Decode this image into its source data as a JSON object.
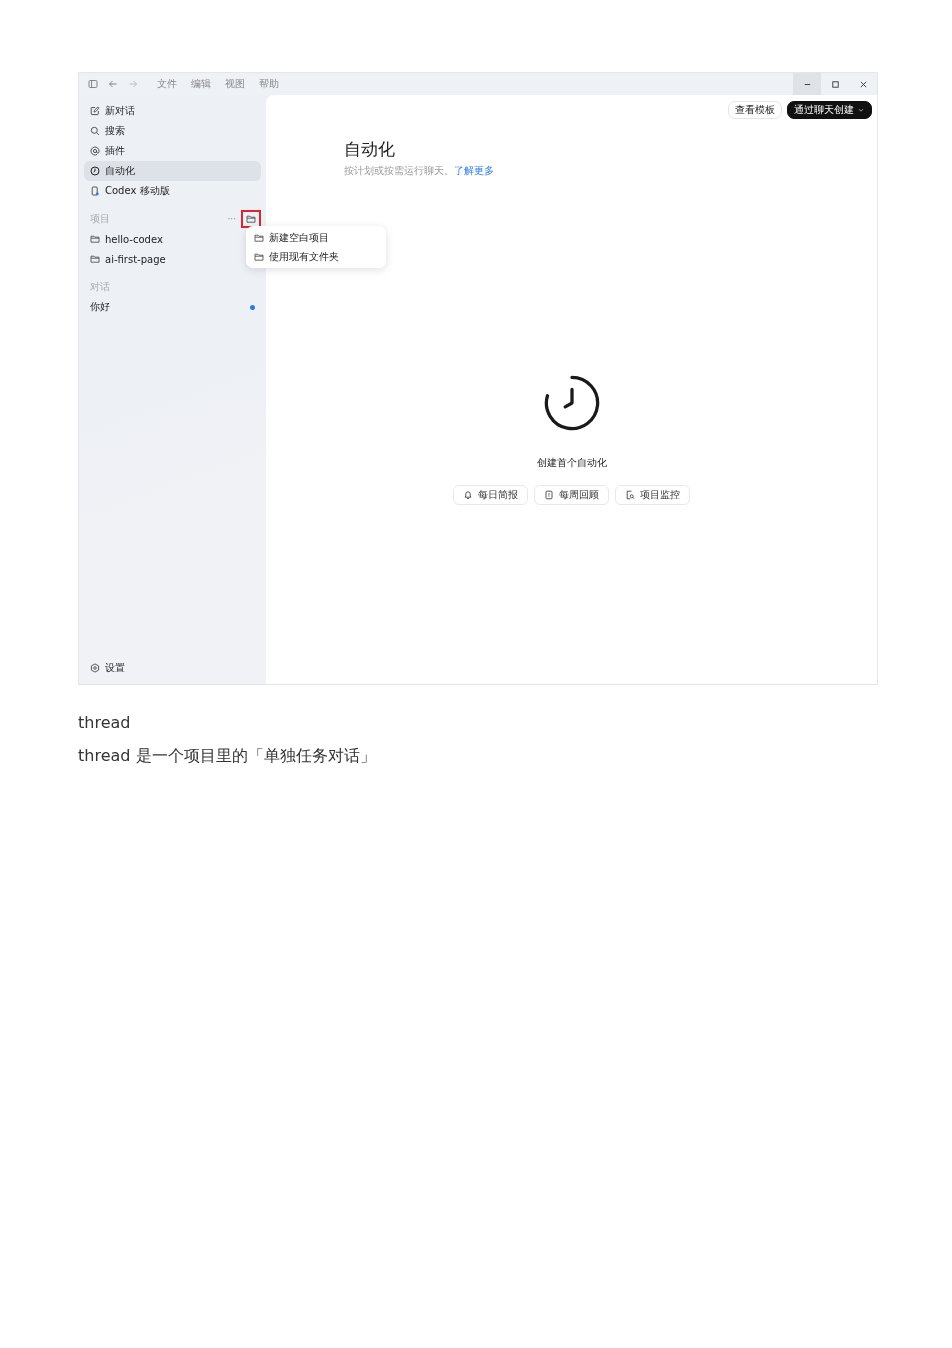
{
  "menu_bar": {
    "items": [
      "文件",
      "编辑",
      "视图",
      "帮助"
    ]
  },
  "sidebar": {
    "nav": [
      {
        "label": "新对话",
        "selected": false
      },
      {
        "label": "搜索",
        "selected": false
      },
      {
        "label": "插件",
        "selected": false
      },
      {
        "label": "自动化",
        "selected": true
      },
      {
        "label": "Codex 移动版",
        "selected": false
      }
    ],
    "projects_heading": "项目",
    "more": "···",
    "new_project_highlighted": true,
    "projects": [
      {
        "label": "hello-codex"
      },
      {
        "label": "ai-first-page"
      }
    ],
    "conversations_heading": "对话",
    "conversations": [
      {
        "label": "你好",
        "unread": true
      }
    ],
    "settings": "设置"
  },
  "popup_menu": {
    "items": [
      "新建空白项目",
      "使用现有文件夹"
    ]
  },
  "main": {
    "buttons": [
      {
        "label": "查看模板",
        "kind": "secondary"
      },
      {
        "label": "通过聊天创建",
        "kind": "primary"
      }
    ],
    "title": "自动化",
    "subtitle": "按计划或按需运行聊天。",
    "link": "了解更多",
    "empty_title": "创建首个自动化",
    "suggestions": [
      {
        "label": "每日简报"
      },
      {
        "label": "每周回顾"
      },
      {
        "label": "项目监控"
      }
    ]
  },
  "document": {
    "heading": "thread",
    "paragraph": "thread 是一个项目里的「单独任务对话」"
  }
}
